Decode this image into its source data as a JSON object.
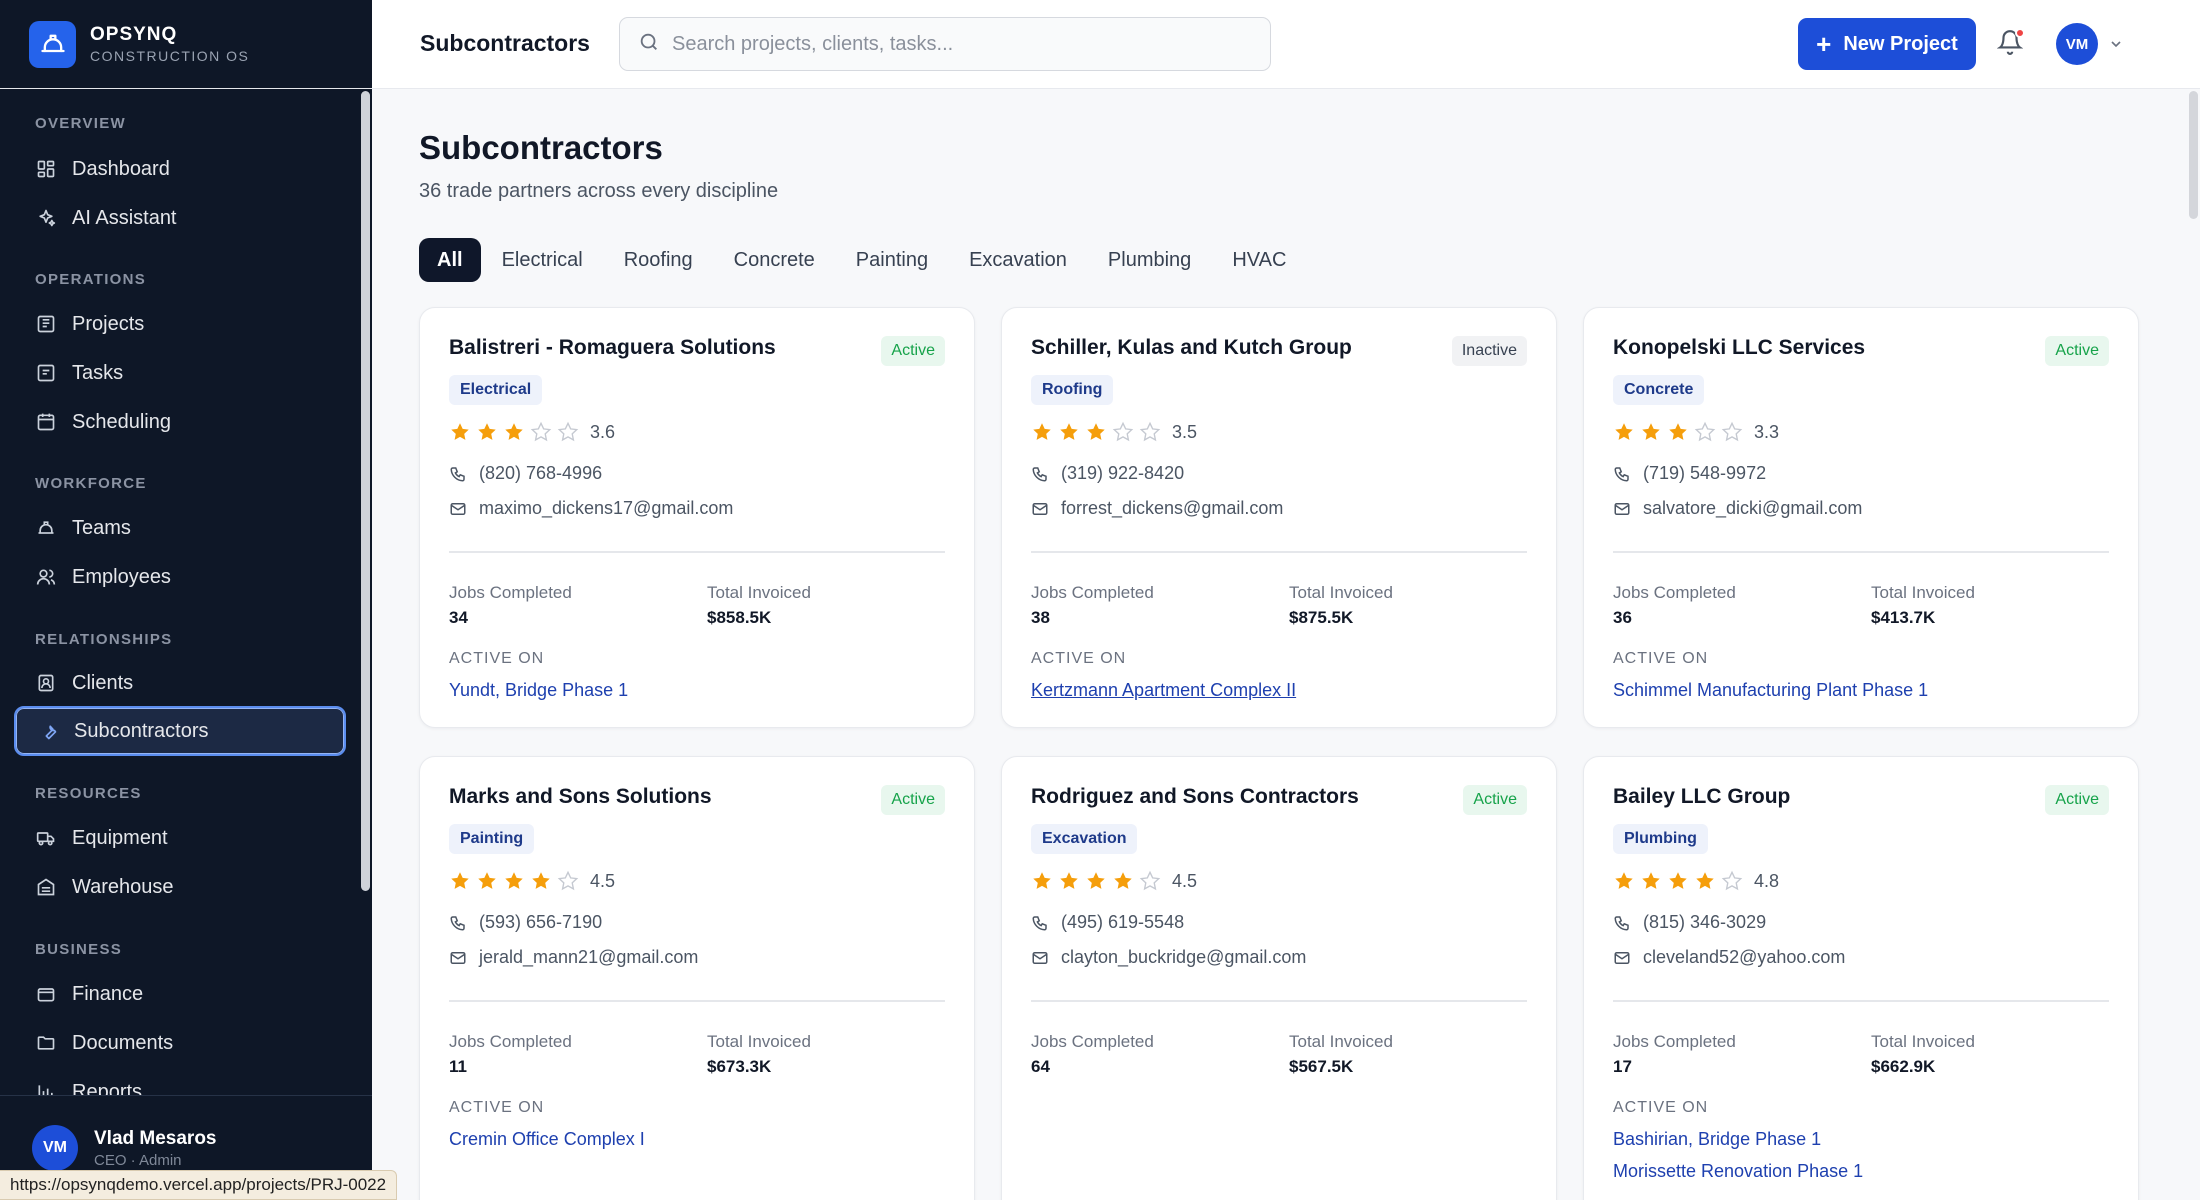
{
  "brand": {
    "name": "OPSYNQ",
    "subtitle": "CONSTRUCTION OS"
  },
  "sidebar": {
    "sections": [
      {
        "label": "OVERVIEW",
        "items": [
          {
            "label": "Dashboard",
            "icon": "dashboard-icon"
          },
          {
            "label": "AI Assistant",
            "icon": "sparkle-icon"
          }
        ]
      },
      {
        "label": "OPERATIONS",
        "items": [
          {
            "label": "Projects",
            "icon": "projects-icon"
          },
          {
            "label": "Tasks",
            "icon": "tasks-icon"
          },
          {
            "label": "Scheduling",
            "icon": "calendar-icon"
          }
        ]
      },
      {
        "label": "WORKFORCE",
        "items": [
          {
            "label": "Teams",
            "icon": "hardhat-icon"
          },
          {
            "label": "Employees",
            "icon": "users-icon"
          }
        ]
      },
      {
        "label": "RELATIONSHIPS",
        "items": [
          {
            "label": "Clients",
            "icon": "contact-icon"
          },
          {
            "label": "Subcontractors",
            "icon": "wrench-icon",
            "active": true
          }
        ]
      },
      {
        "label": "RESOURCES",
        "items": [
          {
            "label": "Equipment",
            "icon": "truck-icon"
          },
          {
            "label": "Warehouse",
            "icon": "warehouse-icon"
          }
        ]
      },
      {
        "label": "BUSINESS",
        "items": [
          {
            "label": "Finance",
            "icon": "wallet-icon"
          },
          {
            "label": "Documents",
            "icon": "folder-icon"
          },
          {
            "label": "Reports",
            "icon": "chart-icon"
          }
        ]
      }
    ],
    "user": {
      "initials": "VM",
      "name": "Vlad Mesaros",
      "role": "CEO · Admin"
    }
  },
  "topbar": {
    "title": "Subcontractors",
    "search_placeholder": "Search projects, clients, tasks...",
    "new_button": "New Project",
    "avatar_initials": "VM"
  },
  "page": {
    "title": "Subcontractors",
    "subtitle": "36 trade partners across every discipline",
    "tabs": [
      "All",
      "Electrical",
      "Roofing",
      "Concrete",
      "Painting",
      "Excavation",
      "Plumbing",
      "HVAC"
    ],
    "active_tab": "All"
  },
  "labels": {
    "jobs_completed": "Jobs Completed",
    "total_invoiced": "Total Invoiced",
    "active_on": "ACTIVE ON"
  },
  "colors": {
    "accent": "#1d4ed8",
    "star": "#f59e0b",
    "active_status": "#16a34a",
    "sidebar_bg": "#0e1727"
  },
  "subcontractors": [
    {
      "name": "Balistreri - Romaguera Solutions",
      "status": "Active",
      "trade": "Electrical",
      "rating": 3.6,
      "rating_text": "3.6",
      "phone": "(820) 768-4996",
      "email": "maximo_dickens17@gmail.com",
      "jobs": "34",
      "invoiced": "$858.5K",
      "projects": [
        "Yundt, Bridge Phase 1"
      ]
    },
    {
      "name": "Schiller, Kulas and Kutch Group",
      "status": "Inactive",
      "trade": "Roofing",
      "rating": 3.5,
      "rating_text": "3.5",
      "phone": "(319) 922-8420",
      "email": "forrest_dickens@gmail.com",
      "jobs": "38",
      "invoiced": "$875.5K",
      "projects": [
        "Kertzmann Apartment Complex II"
      ]
    },
    {
      "name": "Konopelski LLC Services",
      "status": "Active",
      "trade": "Concrete",
      "rating": 3.3,
      "rating_text": "3.3",
      "phone": "(719) 548-9972",
      "email": "salvatore_dicki@gmail.com",
      "jobs": "36",
      "invoiced": "$413.7K",
      "projects": [
        "Schimmel Manufacturing Plant Phase 1"
      ]
    },
    {
      "name": "Marks and Sons Solutions",
      "status": "Active",
      "trade": "Painting",
      "rating": 4.5,
      "rating_text": "4.5",
      "phone": "(593) 656-7190",
      "email": "jerald_mann21@gmail.com",
      "jobs": "11",
      "invoiced": "$673.3K",
      "projects": [
        "Cremin Office Complex I"
      ]
    },
    {
      "name": "Rodriguez and Sons Contractors",
      "status": "Active",
      "trade": "Excavation",
      "rating": 4.5,
      "rating_text": "4.5",
      "phone": "(495) 619-5548",
      "email": "clayton_buckridge@gmail.com",
      "jobs": "64",
      "invoiced": "$567.5K",
      "projects": []
    },
    {
      "name": "Bailey LLC Group",
      "status": "Active",
      "trade": "Plumbing",
      "rating": 4.8,
      "rating_text": "4.8",
      "phone": "(815) 346-3029",
      "email": "cleveland52@yahoo.com",
      "jobs": "17",
      "invoiced": "$662.9K",
      "projects": [
        "Bashirian, Bridge Phase 1",
        "Morissette Renovation Phase 1"
      ]
    }
  ],
  "statusbar": {
    "url": "https://opsynqdemo.vercel.app/projects/PRJ-0022"
  }
}
